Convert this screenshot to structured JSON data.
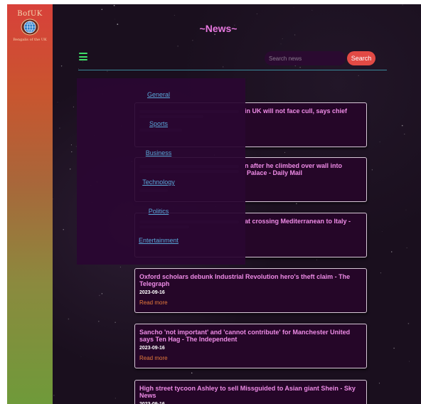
{
  "logo": {
    "title": "BofUK",
    "subtitle": "Bengalis of the UK"
  },
  "header": {
    "title": "~News~"
  },
  "search": {
    "placeholder": "Search news",
    "button_label": "Search"
  },
  "menu": {
    "items": [
      {
        "label": "General"
      },
      {
        "label": "Sports"
      },
      {
        "label": "Business"
      },
      {
        "label": "Technology"
      },
      {
        "label": "Politics"
      },
      {
        "label": "Entertainment"
      }
    ]
  },
  "articles": [
    {
      "title_fragment": "in UK will not face cull, says chief"
    },
    {
      "title_fragment": "n after he climbed over wall into",
      "title_fragment_2": "Palace - Daily Mail"
    },
    {
      "title_fragment": "at crossing Mediterranean to Italy -"
    },
    {
      "title": "Oxford scholars debunk Industrial Revolution hero's theft claim - The Telegraph",
      "date": "2023-09-16",
      "link": "Read more"
    },
    {
      "title": "Sancho 'not important' and 'cannot contribute' for Manchester United says Ten Hag - The Independent",
      "date": "2023-09-16",
      "link": "Read more"
    },
    {
      "title": "High street tycoon Ashley to sell Missguided to Asian giant Shein - Sky News",
      "date": "2023-09-16"
    }
  ],
  "colors": {
    "sidebar_top": "#d8413a",
    "sidebar_bottom": "#6f9a3a",
    "title_pink": "#e879e0",
    "menu_green": "#3fe06a",
    "search_red": "#e24a45",
    "link_orange": "#e67a3c",
    "dropdown_link": "#59a6d8"
  }
}
